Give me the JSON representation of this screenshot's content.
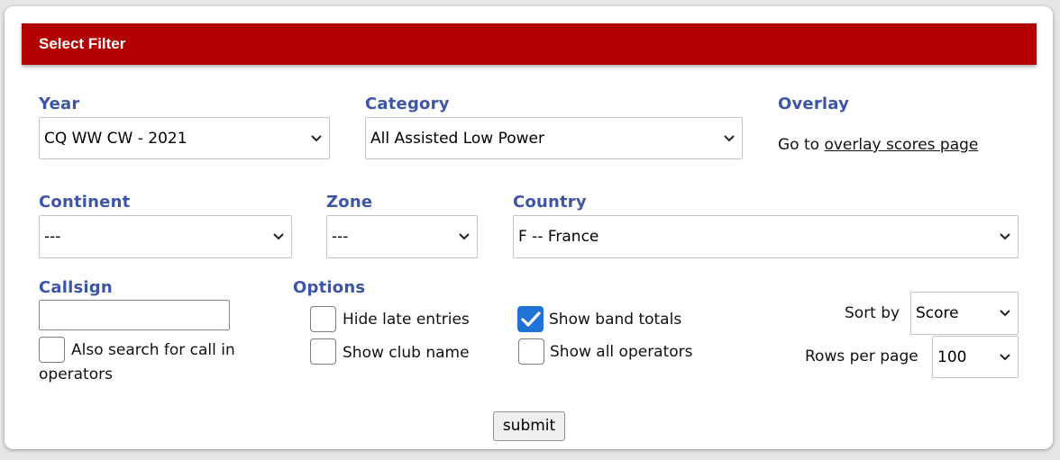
{
  "header": {
    "title": "Select Filter"
  },
  "year": {
    "label": "Year",
    "value": "CQ WW CW - 2021"
  },
  "category": {
    "label": "Category",
    "value": "All Assisted Low Power"
  },
  "overlay": {
    "label": "Overlay",
    "prefix": "Go to ",
    "link": "overlay scores page"
  },
  "continent": {
    "label": "Continent",
    "value": "---"
  },
  "zone": {
    "label": "Zone",
    "value": "---"
  },
  "country": {
    "label": "Country",
    "value": "F -- France"
  },
  "callsign": {
    "label": "Callsign",
    "value": "",
    "also_search_line1": "Also search for call in",
    "also_search_line2": "operators",
    "also_search_checked": false
  },
  "options": {
    "label": "Options",
    "hide_late": {
      "label": "Hide late entries",
      "checked": false
    },
    "show_club": {
      "label": "Show club name",
      "checked": false
    },
    "show_band": {
      "label": "Show band totals",
      "checked": true
    },
    "show_ops": {
      "label": "Show all operators",
      "checked": false
    }
  },
  "sort": {
    "label": "Sort by",
    "value": "Score"
  },
  "rows": {
    "label": "Rows per page",
    "value": "100"
  },
  "submit": {
    "label": "submit"
  },
  "colors": {
    "header_bg": "#b30000",
    "label_blue": "#3d55a6",
    "check_blue": "#1f73d6"
  },
  "icons": {
    "select_arrow": "chevron-down-icon",
    "check": "checkmark-icon"
  }
}
